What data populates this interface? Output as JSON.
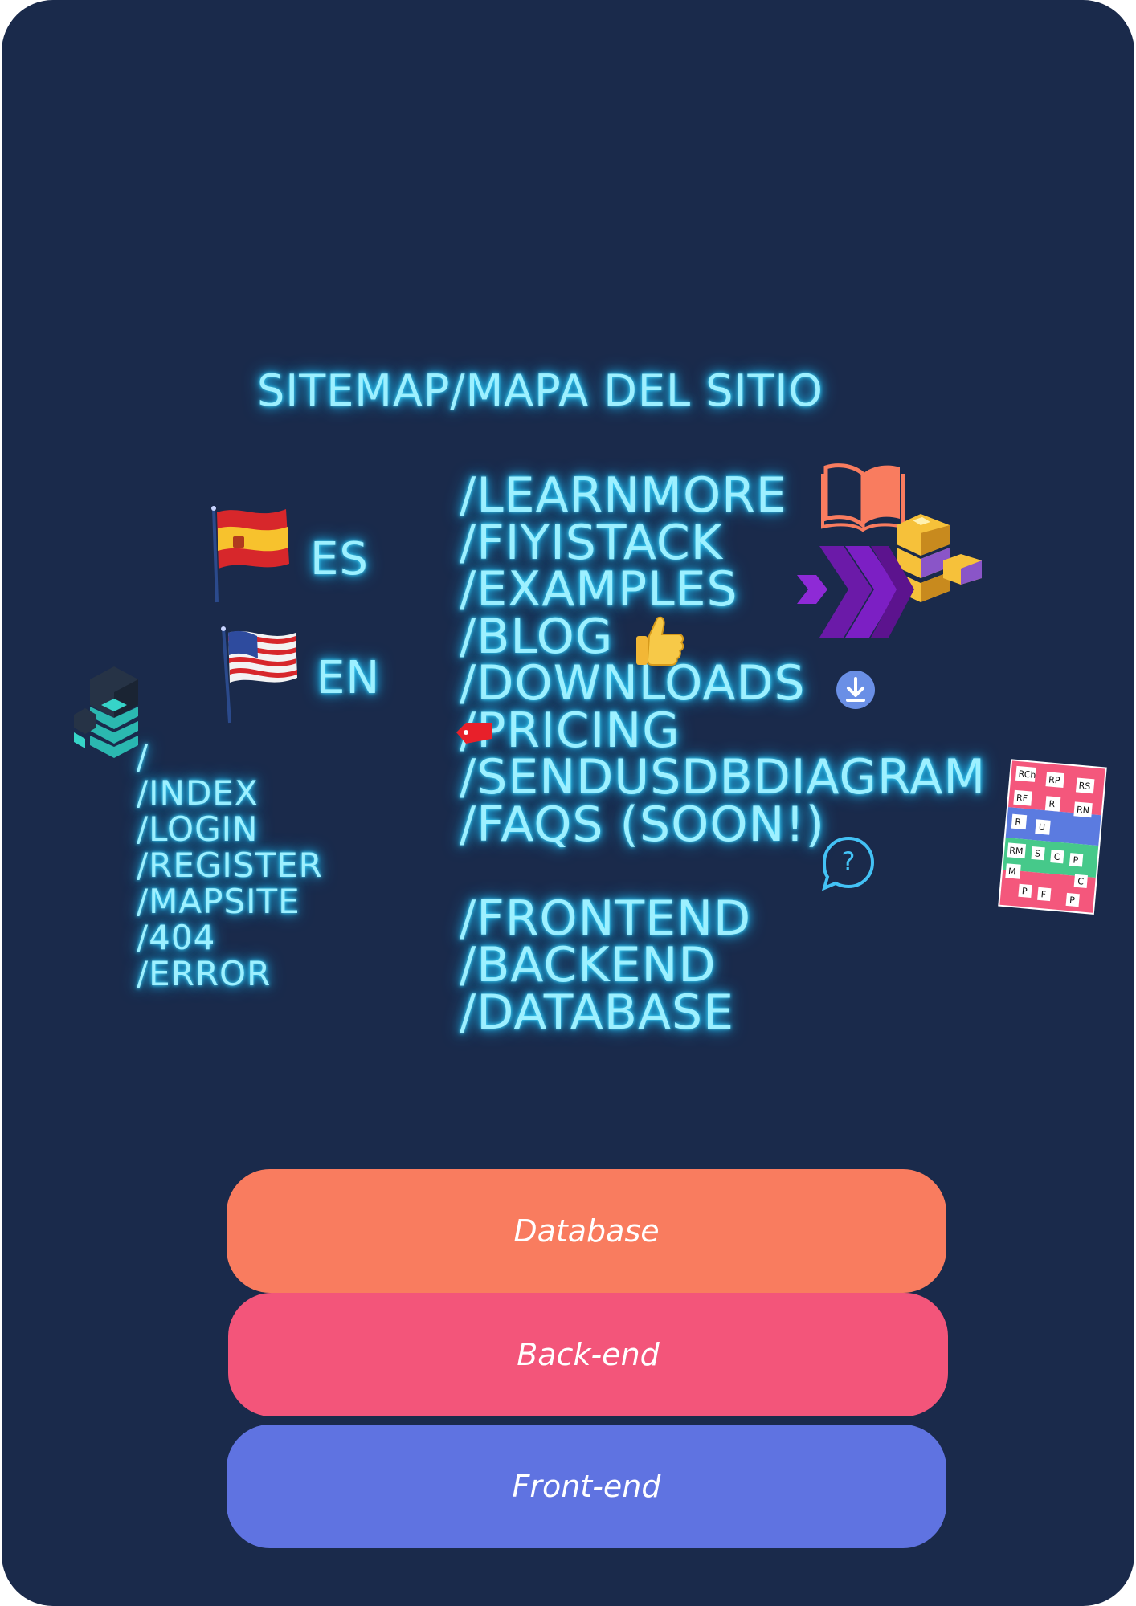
{
  "title": "SITEMAP/MAPA DEL SITIO",
  "languages": {
    "es": "ES",
    "en": "EN"
  },
  "left_routes": [
    "/",
    "/INDEX",
    "/LOGIN",
    "/REGISTER",
    "/MAPSITE",
    "/404",
    "/ERROR"
  ],
  "right_routes": [
    "/LEARNMORE",
    "/FIYISTACK",
    "/EXAMPLES",
    "/BLOG",
    "/DOWNLOADS",
    "/PRICING",
    "/SENDUSDBDIAGRAM",
    "/FAQS (SOON!)"
  ],
  "layer_routes": [
    "/FRONTEND",
    "/BACKEND",
    "/DATABASE"
  ],
  "stack_layers": [
    "Database",
    "Back-end",
    "Front-end"
  ],
  "diagram_thumbnail": {
    "cells": [
      "RCh",
      "RP",
      "RS",
      "RF",
      "R",
      "RN",
      "R",
      "U",
      "RM",
      "S",
      "C",
      "P",
      "M",
      "C",
      "P",
      "F",
      "P"
    ]
  },
  "icons": [
    "spain-flag-icon",
    "usa-flag-icon",
    "cube-stack-logo-icon",
    "open-book-icon",
    "gold-blocks-icon",
    "purple-chevrons-icon",
    "thumbs-up-icon",
    "download-icon",
    "price-tag-icon",
    "question-bubble-icon"
  ],
  "colors": {
    "background": "#1a2a4b",
    "neon_text": "#9df0ff",
    "database_layer": "#f97c5f",
    "backend_layer": "#f3557a",
    "frontend_layer": "#5f73e1"
  }
}
